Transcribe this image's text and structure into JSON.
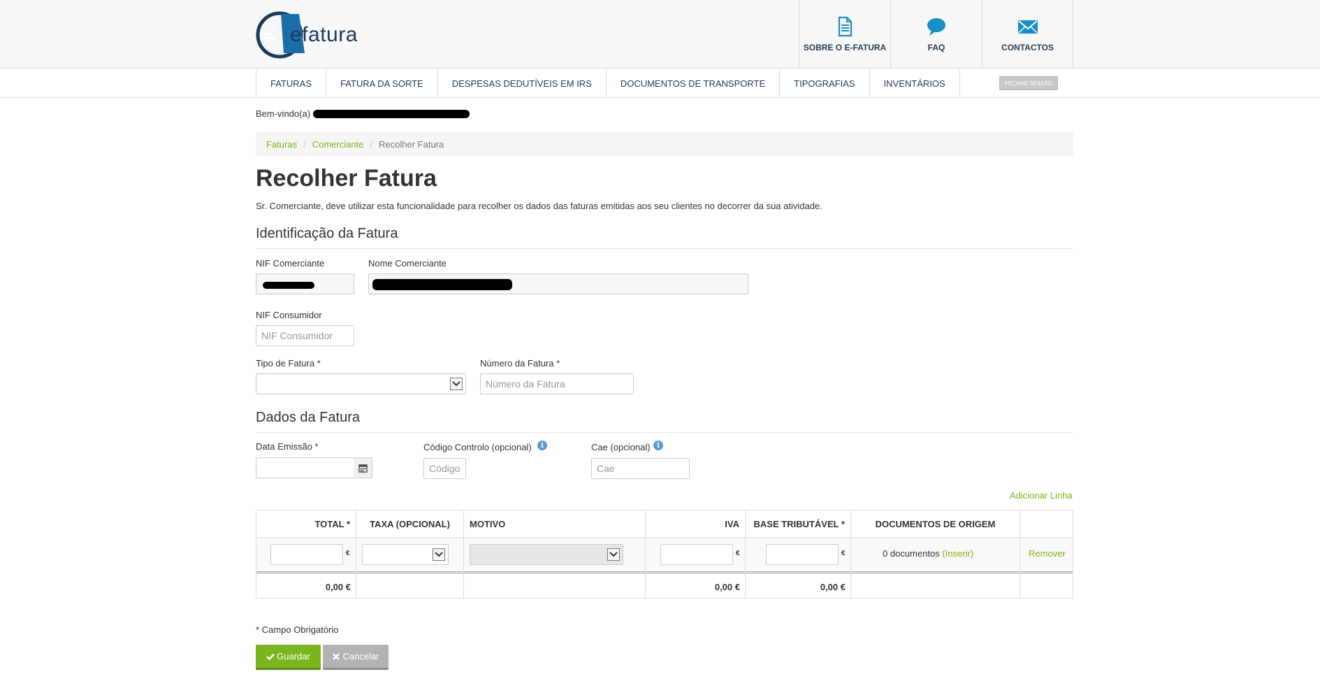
{
  "header": {
    "logo_text": "efatura",
    "nav": [
      {
        "label": "SOBRE O E-FATURA",
        "icon": "document-icon"
      },
      {
        "label": "FAQ",
        "icon": "chat-bubble-icon"
      },
      {
        "label": "CONTACTOS",
        "icon": "envelope-icon"
      }
    ]
  },
  "menu": {
    "items": [
      "FATURAS",
      "FATURA DA SORTE",
      "DESPESAS DEDUTÍVEIS EM IRS",
      "DOCUMENTOS DE TRANSPORTE",
      "TIPOGRAFIAS",
      "INVENTÁRIOS"
    ],
    "logout_label": "FECHAR SESSÃO"
  },
  "welcome_label": "Bem-vindo(a)",
  "breadcrumb": {
    "items": [
      "Faturas",
      "Comerciante"
    ],
    "current": "Recolher Fatura",
    "separator": "/"
  },
  "page": {
    "title": "Recolher Fatura",
    "intro": "Sr. Comerciante, deve utilizar esta funcionalidade para recolher os dados das faturas emitidas aos seu clientes no decorrer da sua atividade."
  },
  "identificacao": {
    "section_title": "Identificação da Fatura",
    "nif_comerciante_label": "NIF Comerciante",
    "nome_comerciante_label": "Nome Comerciante",
    "nif_consumidor_label": "NIF Consumidor",
    "nif_consumidor_placeholder": "NIF Consumidor",
    "tipo_fatura_label": "Tipo de Fatura *",
    "numero_fatura_label": "Número da Fatura *",
    "numero_fatura_placeholder": "Número da Fatura"
  },
  "dados": {
    "section_title": "Dados da Fatura",
    "data_emissao_label": "Data Emissão *",
    "codigo_controlo_label": "Código Controlo (opcional)",
    "codigo_placeholder": "Código",
    "cae_label": "Cae (opcional)",
    "cae_placeholder": "Cae",
    "info_glyph": "i"
  },
  "table": {
    "add_line": "Adicionar Linha",
    "headers": [
      "TOTAL *",
      "TAXA (OPCIONAL)",
      "MOTIVO",
      "IVA",
      "BASE TRIBUTÁVEL *",
      "DOCUMENTOS DE ORIGEM"
    ],
    "currency": "€",
    "docs_count": "0 documentos",
    "insert_link": "(Inserir)",
    "remove_link": "Remover",
    "totals": {
      "total": "0,00 €",
      "iva": "0,00 €",
      "base": "0,00 €"
    }
  },
  "footer": {
    "required_note": "* Campo Obrigatório",
    "save_label": "Guardar",
    "cancel_label": "Cancelar"
  },
  "colors": {
    "accent": "#7ab51d",
    "brand": "#1d3a5c",
    "icon_blue": "#1a8fc5"
  }
}
